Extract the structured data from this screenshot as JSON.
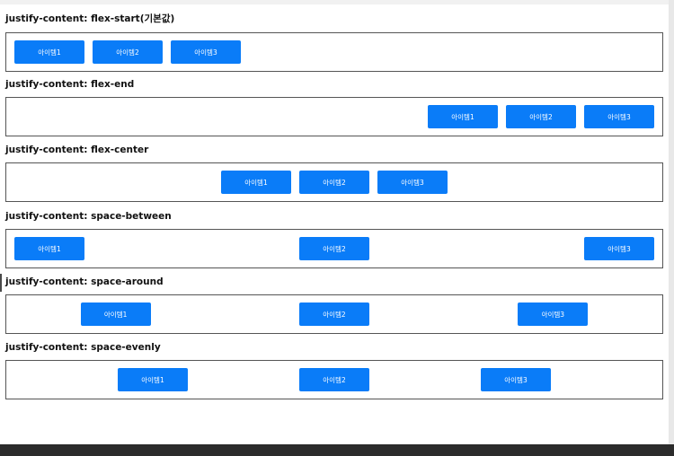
{
  "sections": [
    {
      "heading": "justify-content: flex-start(기본값)",
      "items": [
        "아이템1",
        "아이템2",
        "아이템3"
      ]
    },
    {
      "heading": "justify-content: flex-end",
      "items": [
        "아이템1",
        "아이템2",
        "아이템3"
      ]
    },
    {
      "heading": "justify-content: flex-center",
      "items": [
        "아이템1",
        "아이템2",
        "아이템3"
      ]
    },
    {
      "heading": "justify-content: space-between",
      "items": [
        "아이템1",
        "아이템2",
        "아이템3"
      ]
    },
    {
      "heading": "justify-content: space-around",
      "items": [
        "아이템1",
        "아이템2",
        "아이템3"
      ]
    },
    {
      "heading": "justify-content: space-evenly",
      "items": [
        "아이템1",
        "아이템2",
        "아이템3"
      ]
    }
  ],
  "colors": {
    "item_background": "#0a7cf8",
    "item_text": "#ffffff",
    "container_border": "#555555",
    "page_background": "#ffffff"
  }
}
